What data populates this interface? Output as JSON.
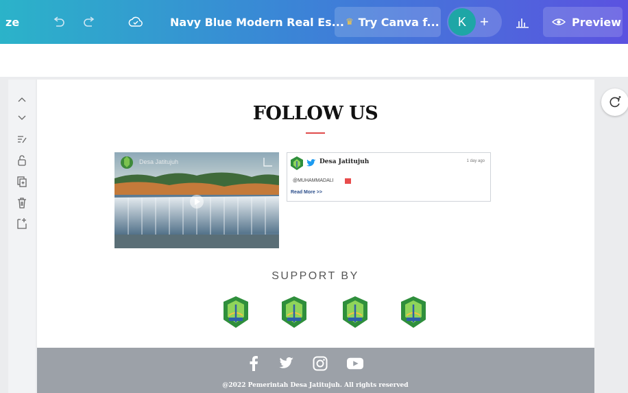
{
  "topbar": {
    "resize_fragment": "ze",
    "doc_title": "Navy Blue Modern Real Es...",
    "try_canva": "Try Canva f...",
    "avatar_initial": "K",
    "add": "+",
    "preview": "Preview"
  },
  "page": {
    "title": "FOLLOW US",
    "video": {
      "channel": "Desa Jatitujuh"
    },
    "tweet": {
      "account": "Desa Jatitujuh",
      "time": "1 day ago",
      "mention": "@MUHAMMADALI",
      "read_more": "Read More >>"
    },
    "support_heading": "SUPPORT BY",
    "footer_copyright": "@2022 Pemerintah Desa Jatitujuh. All rights reserved"
  },
  "colors": {
    "accent_red": "#e04a4a",
    "footer_gray": "#9ca1a8",
    "twitter_blue": "#1d9bf0"
  }
}
